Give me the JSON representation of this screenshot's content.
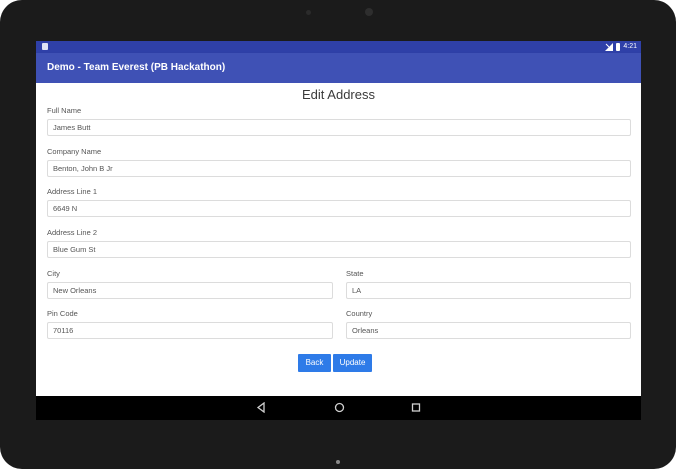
{
  "status_bar": {
    "time": "4:21"
  },
  "app_bar": {
    "title": "Demo - Team Everest (PB Hackathon)"
  },
  "form": {
    "title": "Edit Address",
    "full_name": {
      "label": "Full Name",
      "value": "James Butt"
    },
    "company_name": {
      "label": "Company Name",
      "value": "Benton, John B Jr"
    },
    "address_line_1": {
      "label": "Address Line 1",
      "value": "6649 N"
    },
    "address_line_2": {
      "label": "Address Line 2",
      "value": "Blue Gum St"
    },
    "city": {
      "label": "City",
      "value": "New Orleans"
    },
    "state": {
      "label": "State",
      "value": "LA"
    },
    "pin_code": {
      "label": "Pin Code",
      "value": "70116"
    },
    "country": {
      "label": "Country",
      "value": "Orleans"
    },
    "back_label": "Back",
    "update_label": "Update"
  },
  "nav_bar": {
    "icons": [
      "back-icon",
      "home-icon",
      "recents-icon"
    ]
  },
  "colors": {
    "app_bar": "#3f51b5",
    "status_bar": "#2f40a8",
    "button": "#2e7be8"
  }
}
